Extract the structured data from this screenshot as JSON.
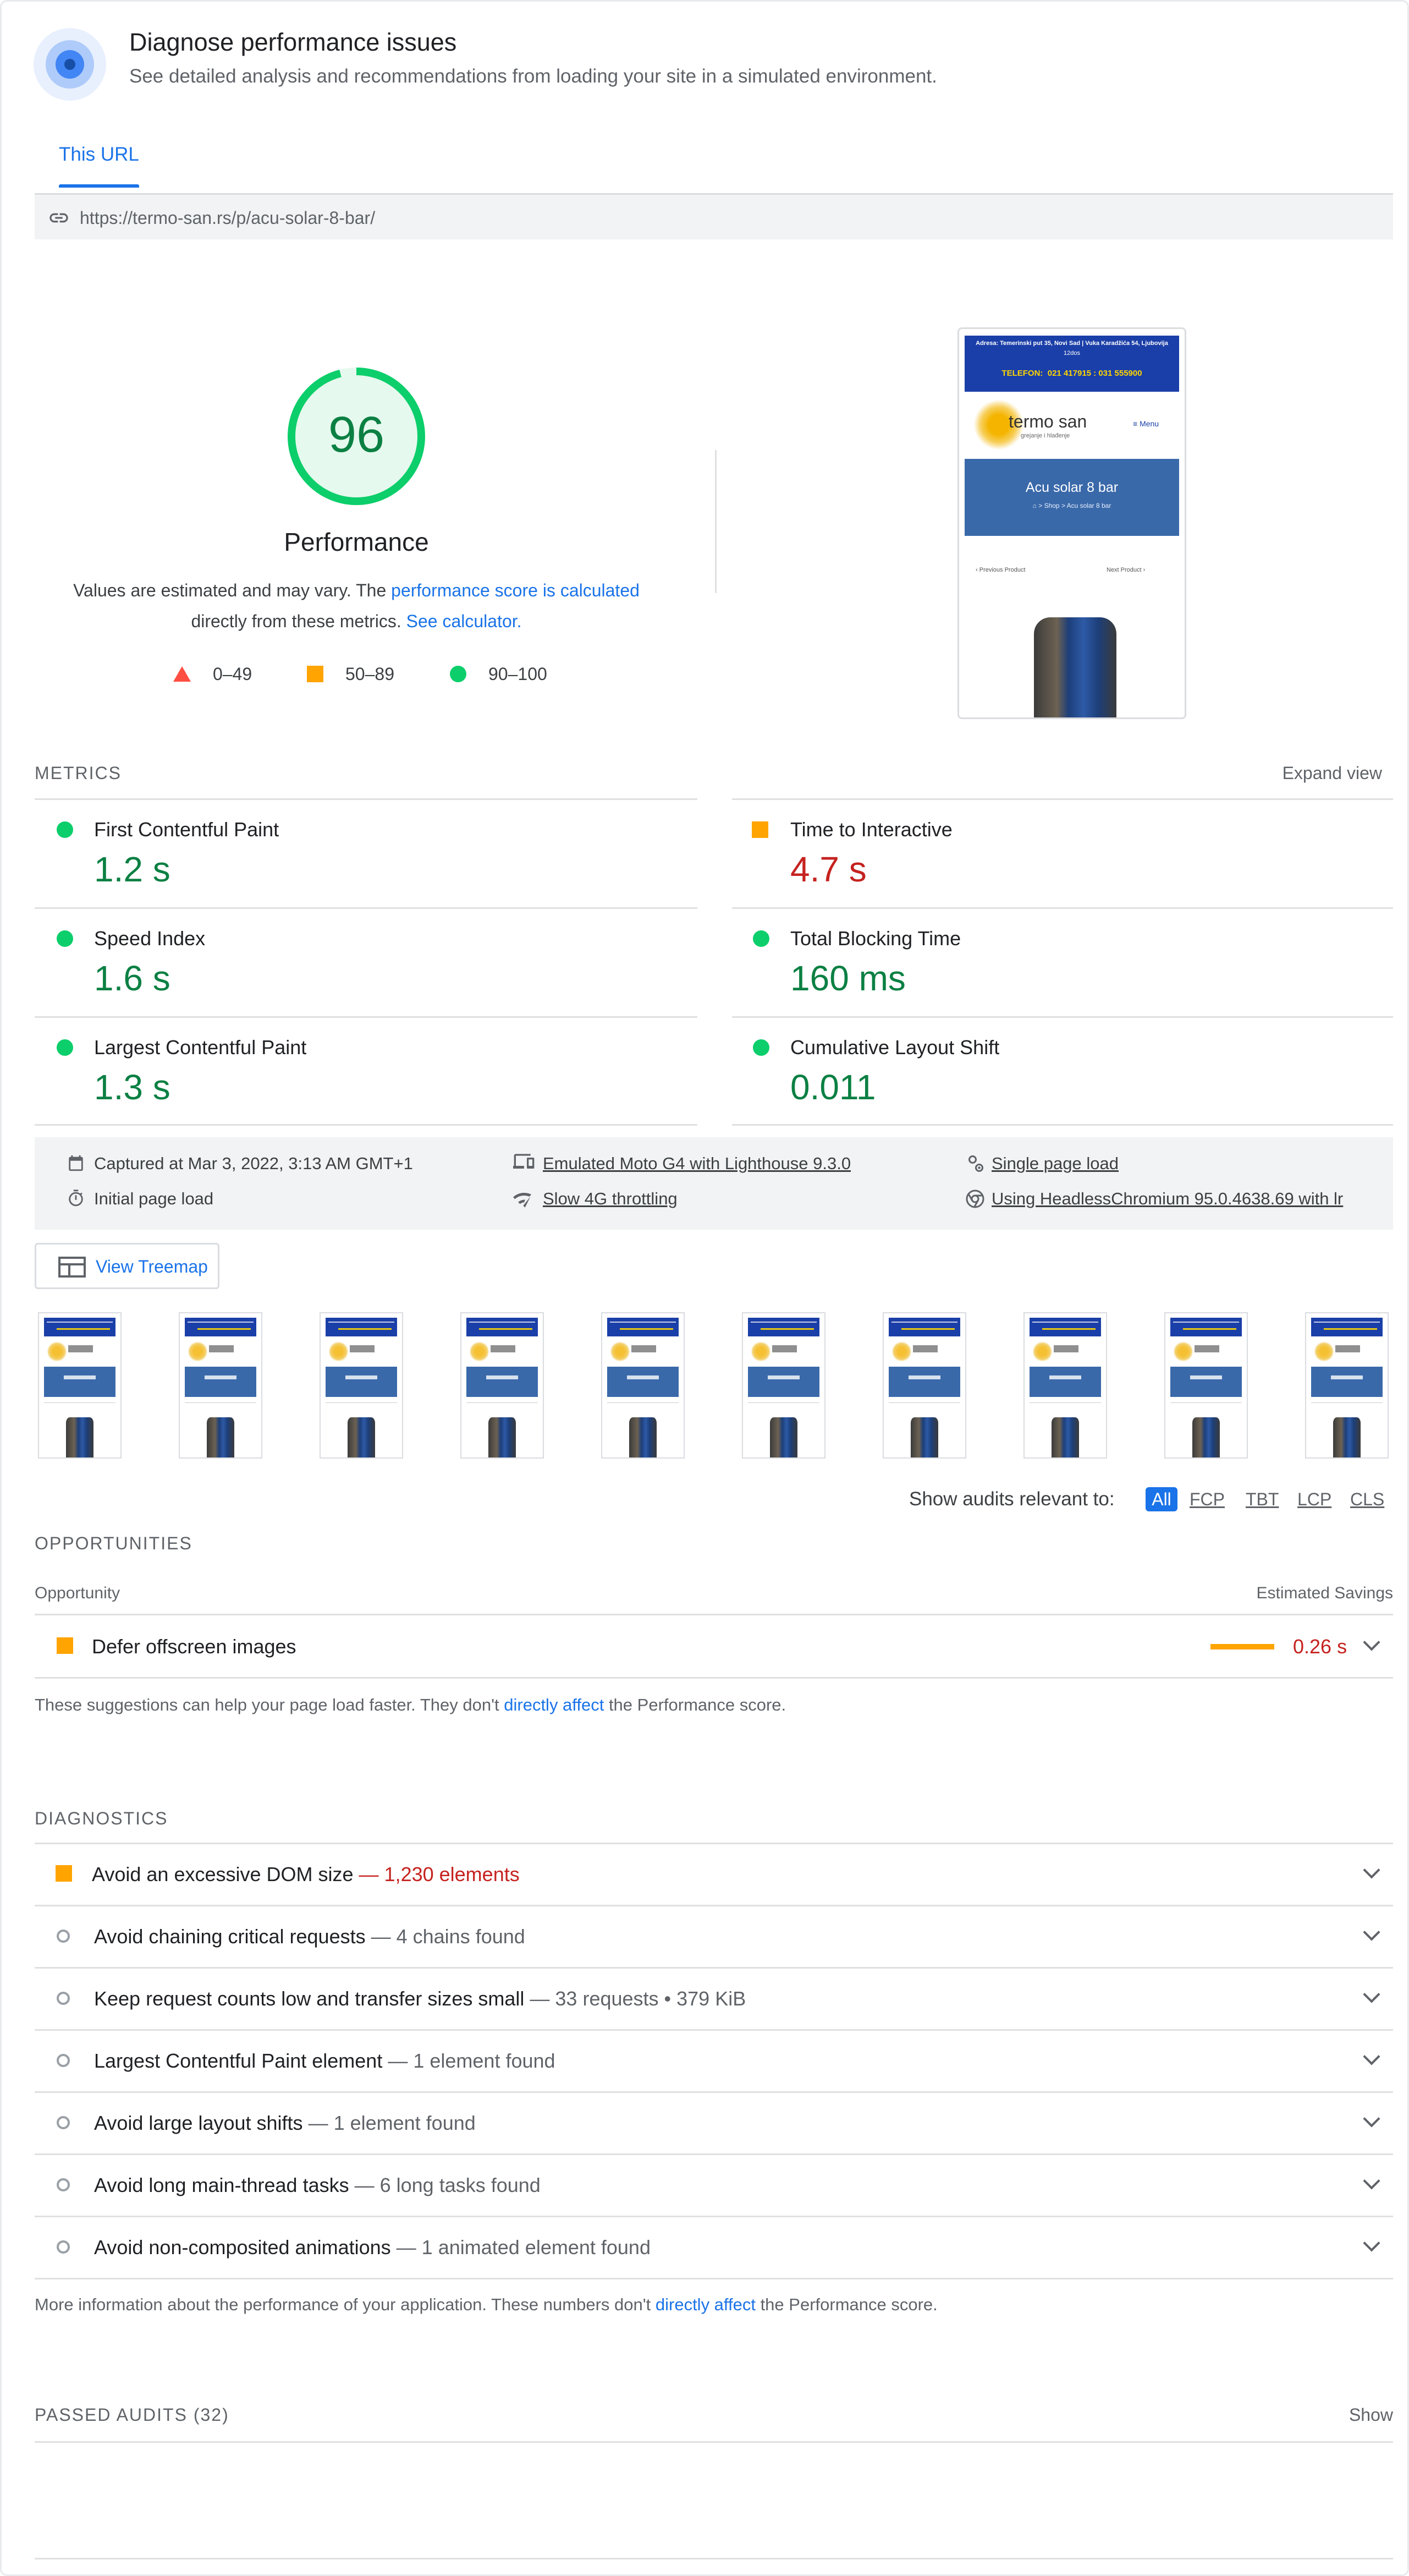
{
  "header": {
    "title": "Diagnose performance issues",
    "subtitle": "See detailed analysis and recommendations from loading your site in a simulated environment.",
    "icon": "gauge-target-icon"
  },
  "tabs": [
    {
      "label": "This URL",
      "active": true
    }
  ],
  "url_bar": {
    "url": "https://termo-san.rs/p/acu-solar-8-bar/",
    "icon": "link-icon"
  },
  "score": {
    "value": "96",
    "fraction": 0.96,
    "label": "Performance",
    "desc_prefix": "Values are estimated and may vary. The ",
    "desc_link1": "performance score is calculated",
    "desc_middle": " directly from these metrics. ",
    "desc_link2": "See calculator.",
    "colors": {
      "pass": "#0cce6b",
      "average": "#ffa400",
      "fail": "#ff4e42"
    }
  },
  "legend": [
    {
      "shape": "triangle",
      "range": "0–49"
    },
    {
      "shape": "square",
      "range": "50–89"
    },
    {
      "shape": "circle",
      "range": "90–100"
    }
  ],
  "screenshot": {
    "address_line": "Adresa: Temerinski put 35, Novi Sad | Vuka Karadžića 54, Ljubovija",
    "address_sub": "12dos",
    "phone": "TELEFON:  021 417915 : 031 555900",
    "logo_text": "termo san",
    "logo_sub": "grejanje i hlađenje",
    "menu": "Menu",
    "product": "Acu solar 8 bar",
    "breadcrumb": "⌂ > Shop > Acu solar 8 bar",
    "prev": "Previous Product",
    "next": "Next Product"
  },
  "metrics_section": {
    "title": "METRICS",
    "expand": "Expand view",
    "items": [
      {
        "name": "First Contentful Paint",
        "value": "1.2 s",
        "status": "pass"
      },
      {
        "name": "Time to Interactive",
        "value": "4.7 s",
        "status": "average"
      },
      {
        "name": "Speed Index",
        "value": "1.6 s",
        "status": "pass"
      },
      {
        "name": "Total Blocking Time",
        "value": "160 ms",
        "status": "pass"
      },
      {
        "name": "Largest Contentful Paint",
        "value": "1.3 s",
        "status": "pass"
      },
      {
        "name": "Cumulative Layout Shift",
        "value": "0.011",
        "status": "pass"
      }
    ]
  },
  "env": {
    "captured": "Captured at Mar 3, 2022, 3:13 AM GMT+1",
    "device": "Emulated Moto G4 with Lighthouse 9.3.0",
    "page_load": "Single page load",
    "initial": "Initial page load",
    "throttle": "Slow 4G throttling",
    "browser": "Using HeadlessChromium 95.0.4638.69 with lr"
  },
  "treemap_button": "View Treemap",
  "filter": {
    "label": "Show audits relevant to:",
    "options": [
      "All",
      "FCP",
      "TBT",
      "LCP",
      "CLS"
    ],
    "active": "All"
  },
  "opportunities": {
    "title": "OPPORTUNITIES",
    "col_left": "Opportunity",
    "col_right": "Estimated Savings",
    "items": [
      {
        "title": "Defer offscreen images",
        "savings": "0.26 s",
        "bar_fraction": 1.0
      }
    ],
    "footnote_prefix": "These suggestions can help your page load faster. They don't ",
    "footnote_link": "directly affect",
    "footnote_suffix": " the Performance score."
  },
  "diagnostics": {
    "title": "DIAGNOSTICS",
    "items": [
      {
        "title": "Avoid an excessive DOM size",
        "detail": "— 1,230 elements",
        "status": "average"
      },
      {
        "title": "Avoid chaining critical requests",
        "detail": "— 4 chains found",
        "status": "info"
      },
      {
        "title": "Keep request counts low and transfer sizes small",
        "detail": "— 33 requests • 379 KiB",
        "status": "info"
      },
      {
        "title": "Largest Contentful Paint element",
        "detail": "— 1 element found",
        "status": "info"
      },
      {
        "title": "Avoid large layout shifts",
        "detail": "— 1 element found",
        "status": "info"
      },
      {
        "title": "Avoid long main-thread tasks",
        "detail": "— 6 long tasks found",
        "status": "info"
      },
      {
        "title": "Avoid non-composited animations",
        "detail": "— 1 animated element found",
        "status": "info"
      }
    ],
    "footnote_prefix": "More information about the performance of your application. These numbers don't ",
    "footnote_link": "directly affect",
    "footnote_suffix": " the Performance score."
  },
  "passed": {
    "title": "PASSED AUDITS",
    "count": "(32)",
    "show": "Show"
  }
}
